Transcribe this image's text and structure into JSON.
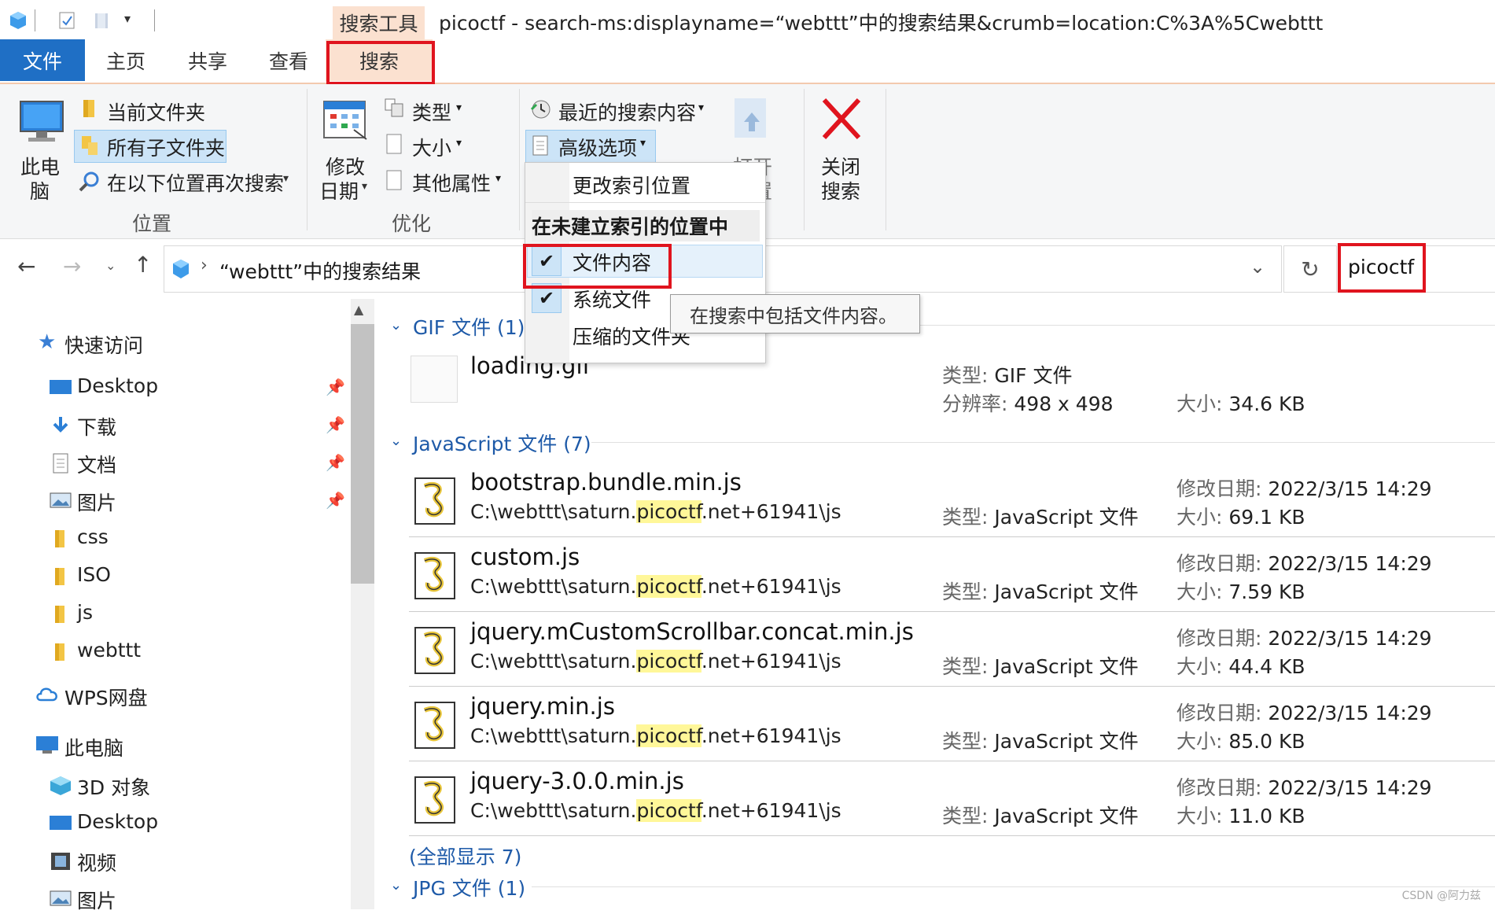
{
  "title": {
    "context_tab": "搜索工具",
    "window_title": "picoctf - search-ms:displayname=“webttt”中的搜索结果&crumb=location:C%3A%5Cwebttt"
  },
  "tabs": {
    "file": "文件",
    "home": "主页",
    "share": "共享",
    "view": "查看",
    "search": "搜索"
  },
  "ribbon": {
    "location": {
      "this_pc_line1": "此电",
      "this_pc_line2": "脑",
      "current_folder": "当前文件夹",
      "all_subfolders": "所有子文件夹",
      "search_again": "在以下位置再次搜索",
      "group_label": "位置"
    },
    "refine": {
      "date_modified_line1": "修改",
      "date_modified_line2": "日期",
      "kind": "类型",
      "size": "大小",
      "other_props": "其他属性",
      "group_label": "优化"
    },
    "options": {
      "recent_searches": "最近的搜索内容",
      "advanced_options": "高级选项",
      "open_location_partial1": "打开",
      "open_location_partial2": "位置"
    },
    "close_search_line1": "关闭",
    "close_search_line2": "搜索"
  },
  "advanced_menu": {
    "change_index": "更改索引位置",
    "section_header": "在未建立索引的位置中",
    "items": [
      {
        "label": "文件内容",
        "checked": true
      },
      {
        "label": "系统文件",
        "checked": true
      },
      {
        "label": "压缩的文件夹",
        "checked": false
      }
    ]
  },
  "tooltip": "在搜索中包括文件内容。",
  "address": {
    "breadcrumb": "“webttt”中的搜索结果",
    "search_value": "picoctf"
  },
  "sidebar": {
    "quick_access": "快速访问",
    "items": [
      {
        "label": "Desktop",
        "pinned": true
      },
      {
        "label": "下载",
        "pinned": true
      },
      {
        "label": "文档",
        "pinned": true
      },
      {
        "label": "图片",
        "pinned": true
      },
      {
        "label": "css",
        "pinned": false
      },
      {
        "label": "ISO",
        "pinned": false
      },
      {
        "label": "js",
        "pinned": false
      },
      {
        "label": "webttt",
        "pinned": false
      }
    ],
    "wps": "WPS网盘",
    "this_pc": "此电脑",
    "pc_items": [
      {
        "label": "3D 对象"
      },
      {
        "label": "Desktop"
      },
      {
        "label": "视频"
      },
      {
        "label": "图片"
      }
    ]
  },
  "results": {
    "gif_group": "GIF 文件 (1)",
    "gif_file": {
      "name": "loading.gif",
      "type_label": "类型:",
      "type_value": "GIF 文件",
      "res_label": "分辨率:",
      "res_value": "498 x 498",
      "size_label": "大小:",
      "size_value": "34.6 KB"
    },
    "js_group": "JavaScript 文件 (7)",
    "path_prefix": "C:\\webttt\\saturn.",
    "path_highlight": "picoctf",
    "path_suffix": ".net+61941\\js",
    "type_label": "类型:",
    "type_value": "JavaScript 文件",
    "date_label": "修改日期:",
    "size_label": "大小:",
    "js_files": [
      {
        "name": "bootstrap.bundle.min.js",
        "date": "2022/3/15 14:29",
        "size": "69.1 KB"
      },
      {
        "name": "custom.js",
        "date": "2022/3/15 14:29",
        "size": "7.59 KB"
      },
      {
        "name": "jquery.mCustomScrollbar.concat.min.js",
        "date": "2022/3/15 14:29",
        "size": "44.4 KB"
      },
      {
        "name": "jquery.min.js",
        "date": "2022/3/15 14:29",
        "size": "85.0 KB"
      },
      {
        "name": "jquery-3.0.0.min.js",
        "date": "2022/3/15 14:29",
        "size": "11.0 KB"
      }
    ],
    "show_all": "(全部显示 7)",
    "jpg_group": "JPG 文件 (1)"
  },
  "watermark": "CSDN @阿力兹"
}
